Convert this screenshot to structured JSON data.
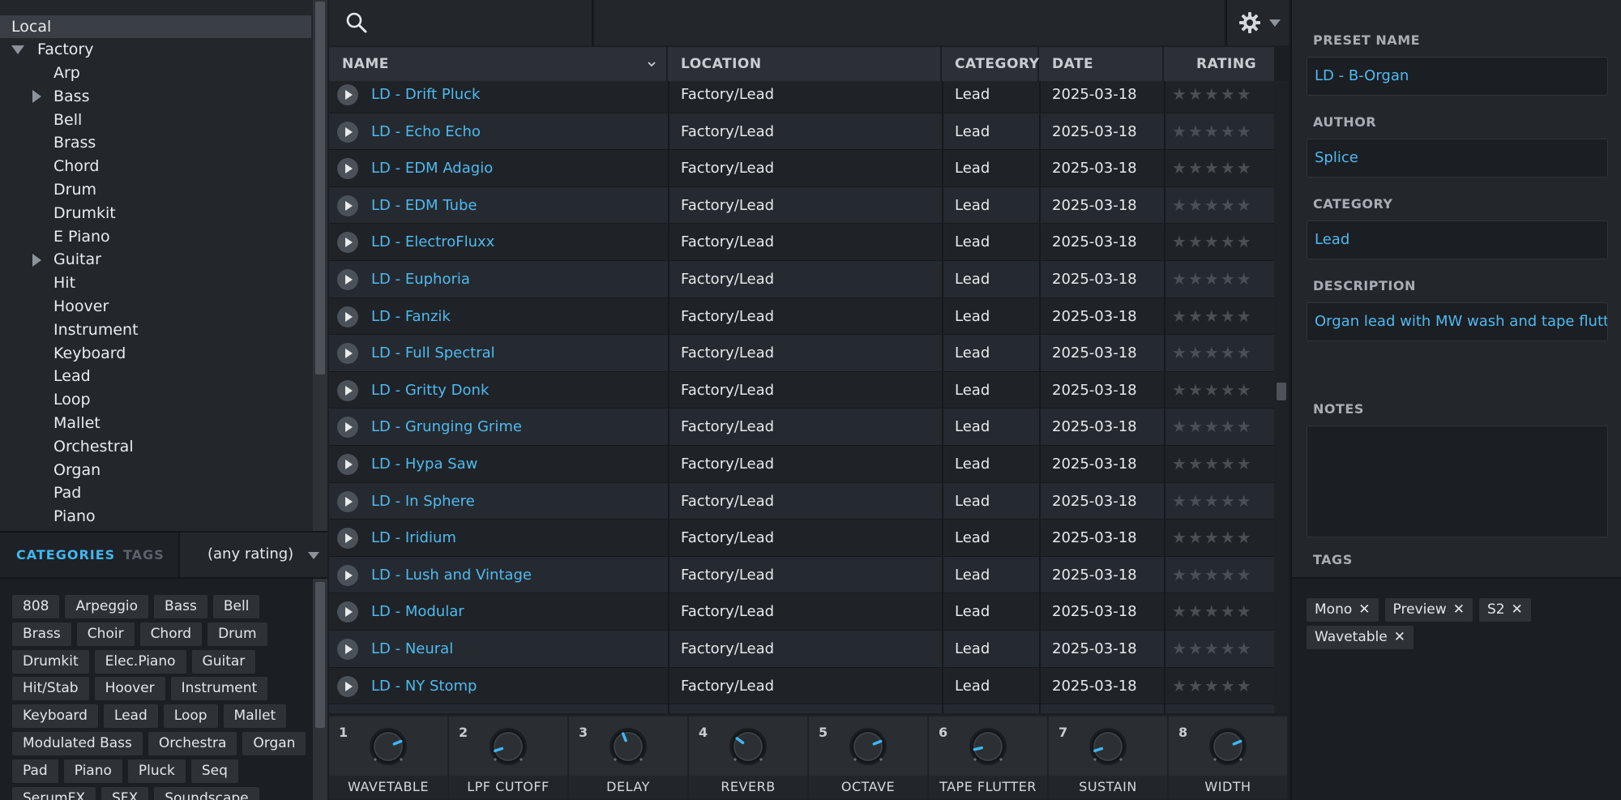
{
  "tree": {
    "root": "Local",
    "factory": "Factory",
    "items": [
      {
        "label": "Arp",
        "expandable": false
      },
      {
        "label": "Bass",
        "expandable": true
      },
      {
        "label": "Bell",
        "expandable": false
      },
      {
        "label": "Brass",
        "expandable": false
      },
      {
        "label": "Chord",
        "expandable": false
      },
      {
        "label": "Drum",
        "expandable": false
      },
      {
        "label": "Drumkit",
        "expandable": false
      },
      {
        "label": "E Piano",
        "expandable": false
      },
      {
        "label": "Guitar",
        "expandable": true
      },
      {
        "label": "Hit",
        "expandable": false
      },
      {
        "label": "Hoover",
        "expandable": false
      },
      {
        "label": "Instrument",
        "expandable": false
      },
      {
        "label": "Keyboard",
        "expandable": false
      },
      {
        "label": "Lead",
        "expandable": false
      },
      {
        "label": "Loop",
        "expandable": false
      },
      {
        "label": "Mallet",
        "expandable": false
      },
      {
        "label": "Orchestral",
        "expandable": false
      },
      {
        "label": "Organ",
        "expandable": false
      },
      {
        "label": "Pad",
        "expandable": false
      },
      {
        "label": "Piano",
        "expandable": false
      }
    ]
  },
  "filter_tabs": {
    "categories": "CATEGORIES",
    "tags": "TAGS",
    "rating": "(any rating)"
  },
  "category_chips": [
    [
      "808",
      "Arpeggio",
      "Bass",
      "Bell"
    ],
    [
      "Brass",
      "Choir",
      "Chord",
      "Drum"
    ],
    [
      "Drumkit",
      "Elec.Piano",
      "Guitar"
    ],
    [
      "Hit/Stab",
      "Hoover",
      "Instrument"
    ],
    [
      "Keyboard",
      "Lead",
      "Loop",
      "Mallet"
    ],
    [
      "Modulated Bass",
      "Orchestra",
      "Organ"
    ],
    [
      "Pad",
      "Piano",
      "Pluck",
      "Seq"
    ],
    [
      "SerumFX",
      "SFX",
      "Soundscape"
    ]
  ],
  "search": {
    "placeholder": ""
  },
  "table": {
    "headers": {
      "name": "NAME",
      "location": "LOCATION",
      "category": "CATEGORY",
      "date": "DATE MODIFIED",
      "rating": "RATING"
    },
    "rows": [
      {
        "name": "LD - Drift Pluck",
        "location": "Factory/Lead",
        "category": "Lead",
        "date": "2025-03-18",
        "rating": 0
      },
      {
        "name": "LD - Echo Echo",
        "location": "Factory/Lead",
        "category": "Lead",
        "date": "2025-03-18",
        "rating": 0
      },
      {
        "name": "LD - EDM Adagio",
        "location": "Factory/Lead",
        "category": "Lead",
        "date": "2025-03-18",
        "rating": 0
      },
      {
        "name": "LD - EDM Tube",
        "location": "Factory/Lead",
        "category": "Lead",
        "date": "2025-03-18",
        "rating": 0
      },
      {
        "name": "LD - ElectroFluxx",
        "location": "Factory/Lead",
        "category": "Lead",
        "date": "2025-03-18",
        "rating": 0
      },
      {
        "name": "LD - Euphoria",
        "location": "Factory/Lead",
        "category": "Lead",
        "date": "2025-03-18",
        "rating": 0
      },
      {
        "name": "LD - Fanzik",
        "location": "Factory/Lead",
        "category": "Lead",
        "date": "2025-03-18",
        "rating": 0
      },
      {
        "name": "LD - Full Spectral",
        "location": "Factory/Lead",
        "category": "Lead",
        "date": "2025-03-18",
        "rating": 0
      },
      {
        "name": "LD - Gritty Donk",
        "location": "Factory/Lead",
        "category": "Lead",
        "date": "2025-03-18",
        "rating": 0
      },
      {
        "name": "LD - Grunging Grime",
        "location": "Factory/Lead",
        "category": "Lead",
        "date": "2025-03-18",
        "rating": 0
      },
      {
        "name": "LD - Hypa Saw",
        "location": "Factory/Lead",
        "category": "Lead",
        "date": "2025-03-18",
        "rating": 0
      },
      {
        "name": "LD - In Sphere",
        "location": "Factory/Lead",
        "category": "Lead",
        "date": "2025-03-18",
        "rating": 0
      },
      {
        "name": "LD - Iridium",
        "location": "Factory/Lead",
        "category": "Lead",
        "date": "2025-03-18",
        "rating": 0
      },
      {
        "name": "LD - Lush and Vintage",
        "location": "Factory/Lead",
        "category": "Lead",
        "date": "2025-03-18",
        "rating": 0
      },
      {
        "name": "LD - Modular",
        "location": "Factory/Lead",
        "category": "Lead",
        "date": "2025-03-18",
        "rating": 0
      },
      {
        "name": "LD - Neural",
        "location": "Factory/Lead",
        "category": "Lead",
        "date": "2025-03-18",
        "rating": 0
      },
      {
        "name": "LD - NY Stomp",
        "location": "Factory/Lead",
        "category": "Lead",
        "date": "2025-03-18",
        "rating": 0
      }
    ]
  },
  "macros": [
    {
      "num": "1",
      "label": "WAVETABLE",
      "value": 0.75
    },
    {
      "num": "2",
      "label": "LPF CUTOFF",
      "value": 0.1
    },
    {
      "num": "3",
      "label": "DELAY",
      "value": 0.42
    },
    {
      "num": "4",
      "label": "REVERB",
      "value": 0.3
    },
    {
      "num": "5",
      "label": "OCTAVE",
      "value": 0.75
    },
    {
      "num": "6",
      "label": "TAPE FLUTTER",
      "value": 0.12
    },
    {
      "num": "7",
      "label": "SUSTAIN",
      "value": 0.1
    },
    {
      "num": "8",
      "label": "WIDTH",
      "value": 0.75
    }
  ],
  "inspector": {
    "preset_name_label": "PRESET NAME",
    "preset_name": "LD - B-Organ",
    "author_label": "AUTHOR",
    "author": "Splice",
    "category_label": "CATEGORY",
    "category": "Lead",
    "description_label": "DESCRIPTION",
    "description": "Organ lead with MW wash and tape flutter",
    "notes_label": "NOTES",
    "notes": "",
    "tags_label": "TAGS",
    "tags": [
      "Mono",
      "Preview",
      "S2",
      "Wavetable"
    ]
  },
  "colors": {
    "accent": "#3fb7f2",
    "link": "#4fbaf0",
    "knob_indicator": "#3fb7f2"
  }
}
